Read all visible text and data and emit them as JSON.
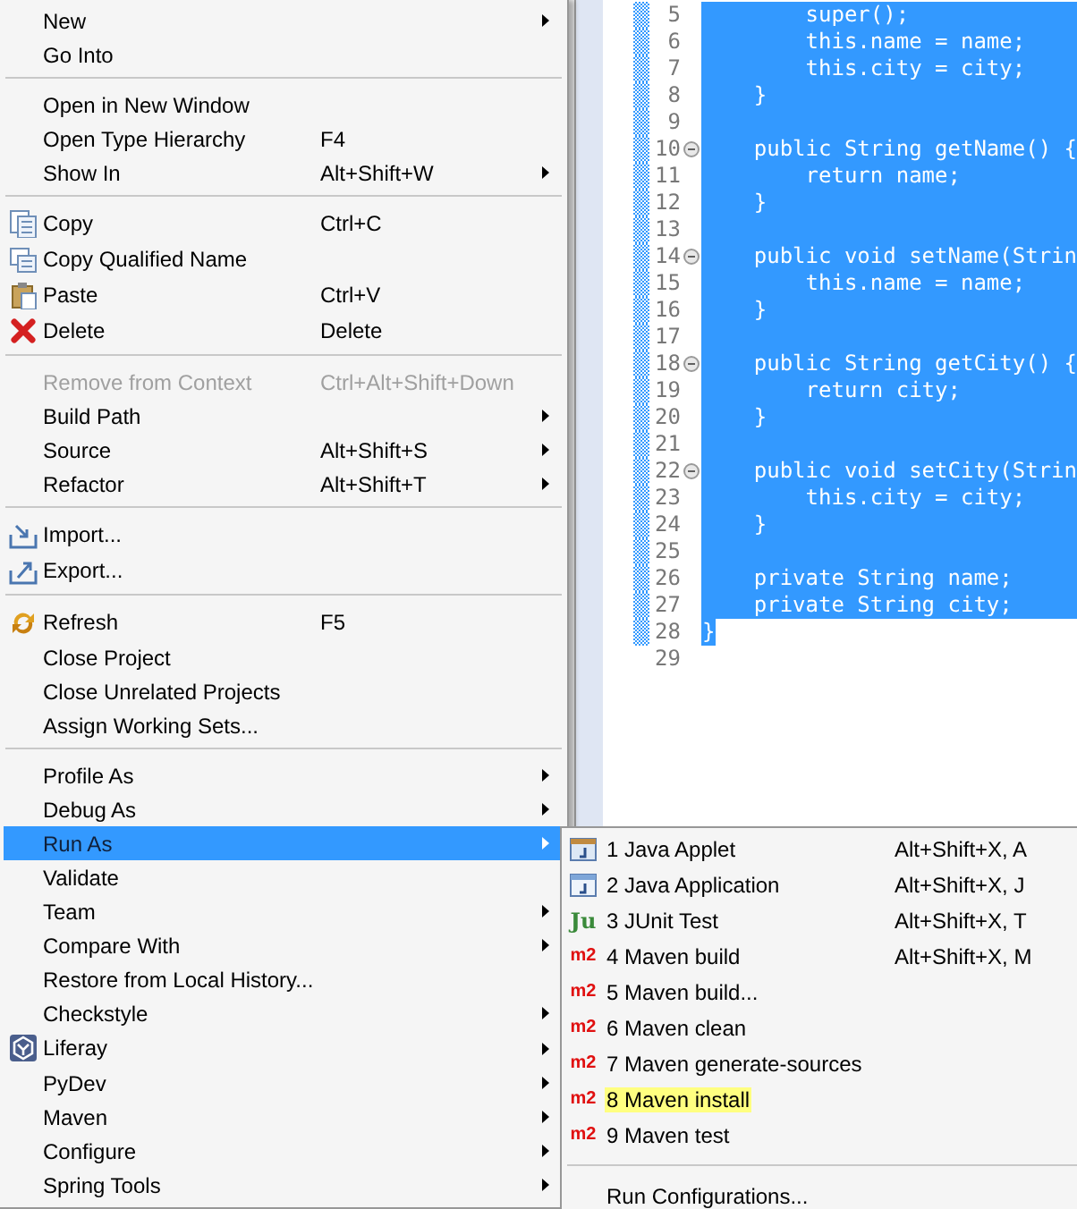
{
  "editor": {
    "lines": [
      {
        "number": "5",
        "code": "        super();",
        "selected": true,
        "folding": false
      },
      {
        "number": "6",
        "code": "        this.name = name;",
        "selected": true,
        "folding": false
      },
      {
        "number": "7",
        "code": "        this.city = city;",
        "selected": true,
        "folding": false
      },
      {
        "number": "8",
        "code": "    }",
        "selected": true,
        "folding": false
      },
      {
        "number": "9",
        "selected": true,
        "folding": false
      },
      {
        "number": "10",
        "code": "    public String getName() {",
        "selected": true,
        "folding": true
      },
      {
        "number": "11",
        "code": "        return name;",
        "selected": true,
        "folding": false
      },
      {
        "number": "12",
        "code": "    }",
        "selected": true,
        "folding": false
      },
      {
        "number": "13",
        "selected": true,
        "folding": false
      },
      {
        "number": "14",
        "code": "    public void setName(Strin",
        "selected": true,
        "folding": true
      },
      {
        "number": "15",
        "code": "        this.name = name;",
        "selected": true,
        "folding": false
      },
      {
        "number": "16",
        "code": "    }",
        "selected": true,
        "folding": false
      },
      {
        "number": "17",
        "selected": true,
        "folding": false
      },
      {
        "number": "18",
        "code": "    public String getCity() {",
        "selected": true,
        "folding": true
      },
      {
        "number": "19",
        "code": "        return city;",
        "selected": true,
        "folding": false
      },
      {
        "number": "20",
        "code": "    }",
        "selected": true,
        "folding": false
      },
      {
        "number": "21",
        "selected": true,
        "folding": false
      },
      {
        "number": "22",
        "code": "    public void setCity(Strin",
        "selected": true,
        "folding": true
      },
      {
        "number": "23",
        "code": "        this.city = city;",
        "selected": true,
        "folding": false
      },
      {
        "number": "24",
        "code": "    }",
        "selected": true,
        "folding": false
      },
      {
        "number": "25",
        "selected": true,
        "folding": false
      },
      {
        "number": "26",
        "code": "    private String name;",
        "selected": true,
        "folding": false
      },
      {
        "number": "27",
        "code": "    private String city;",
        "selected": true,
        "folding": false
      },
      {
        "number": "28",
        "code": "}",
        "selected": true,
        "folding": false
      },
      {
        "number": "29",
        "selected": false,
        "folding": false
      }
    ]
  },
  "context_menu": {
    "groups": [
      [
        {
          "label": "New",
          "submenu": true,
          "selected": false,
          "disabled": false
        },
        {
          "label": "Go Into",
          "submenu": false,
          "selected": false,
          "disabled": false
        }
      ],
      [
        {
          "label": "Open in New Window",
          "submenu": false,
          "selected": false,
          "disabled": false
        },
        {
          "label": "Open Type Hierarchy",
          "shortcut": "F4",
          "submenu": false,
          "selected": false,
          "disabled": false
        },
        {
          "label": "Show In",
          "shortcut": "Alt+Shift+W",
          "submenu": true,
          "selected": false,
          "disabled": false
        }
      ],
      [
        {
          "label": "Copy",
          "shortcut": "Ctrl+C",
          "kind": "copy",
          "submenu": false,
          "selected": false,
          "disabled": false
        },
        {
          "label": "Copy Qualified Name",
          "kind": "copy-qualified",
          "submenu": false,
          "selected": false,
          "disabled": false
        },
        {
          "label": "Paste",
          "shortcut": "Ctrl+V",
          "kind": "paste",
          "submenu": false,
          "selected": false,
          "disabled": false
        },
        {
          "label": "Delete",
          "shortcut": "Delete",
          "kind": "delete",
          "submenu": false,
          "selected": false,
          "disabled": false
        }
      ],
      [
        {
          "label": "Remove from Context",
          "shortcut": "Ctrl+Alt+Shift+Down",
          "submenu": false,
          "selected": false,
          "disabled": true
        },
        {
          "label": "Build Path",
          "submenu": true,
          "selected": false,
          "disabled": false
        },
        {
          "label": "Source",
          "shortcut": "Alt+Shift+S",
          "submenu": true,
          "selected": false,
          "disabled": false
        },
        {
          "label": "Refactor",
          "shortcut": "Alt+Shift+T",
          "submenu": true,
          "selected": false,
          "disabled": false
        }
      ],
      [
        {
          "label": "Import...",
          "kind": "import",
          "submenu": false,
          "selected": false,
          "disabled": false
        },
        {
          "label": "Export...",
          "kind": "export",
          "submenu": false,
          "selected": false,
          "disabled": false
        }
      ],
      [
        {
          "label": "Refresh",
          "shortcut": "F5",
          "kind": "refresh",
          "submenu": false,
          "selected": false,
          "disabled": false
        },
        {
          "label": "Close Project",
          "submenu": false,
          "selected": false,
          "disabled": false
        },
        {
          "label": "Close Unrelated Projects",
          "submenu": false,
          "selected": false,
          "disabled": false
        },
        {
          "label": "Assign Working Sets...",
          "submenu": false,
          "selected": false,
          "disabled": false
        }
      ],
      [
        {
          "label": "Profile As",
          "submenu": true,
          "selected": false,
          "disabled": false
        },
        {
          "label": "Debug As",
          "submenu": true,
          "selected": false,
          "disabled": false
        },
        {
          "label": "Run As",
          "submenu": true,
          "selected": true,
          "disabled": false
        },
        {
          "label": "Validate",
          "submenu": false,
          "selected": false,
          "disabled": false
        },
        {
          "label": "Team",
          "submenu": true,
          "selected": false,
          "disabled": false
        },
        {
          "label": "Compare With",
          "submenu": true,
          "selected": false,
          "disabled": false
        },
        {
          "label": "Restore from Local History...",
          "submenu": false,
          "selected": false,
          "disabled": false
        },
        {
          "label": "Checkstyle",
          "submenu": true,
          "selected": false,
          "disabled": false
        },
        {
          "label": "Liferay",
          "kind": "liferay",
          "submenu": true,
          "selected": false,
          "disabled": false
        },
        {
          "label": "PyDev",
          "submenu": true,
          "selected": false,
          "disabled": false
        },
        {
          "label": "Maven",
          "submenu": true,
          "selected": false,
          "disabled": false
        },
        {
          "label": "Configure",
          "submenu": true,
          "selected": false,
          "disabled": false
        },
        {
          "label": "Spring Tools",
          "submenu": true,
          "selected": false,
          "disabled": false
        }
      ]
    ]
  },
  "run_as_submenu": {
    "groups": [
      [
        {
          "kind": "applet",
          "label": "1 Java Applet",
          "shortcut": "Alt+Shift+X, A",
          "highlighted": false
        },
        {
          "kind": "application",
          "label": "2 Java Application",
          "shortcut": "Alt+Shift+X, J",
          "highlighted": false
        },
        {
          "kind": "junit",
          "badge": "Ju",
          "label": "3 JUnit Test",
          "shortcut": "Alt+Shift+X, T",
          "highlighted": false
        },
        {
          "kind": "maven",
          "badge": "m2",
          "label": "4 Maven build",
          "shortcut": "Alt+Shift+X, M",
          "highlighted": false
        },
        {
          "kind": "maven",
          "badge": "m2",
          "label": "5 Maven build...",
          "highlighted": false
        },
        {
          "kind": "maven",
          "badge": "m2",
          "label": "6 Maven clean",
          "highlighted": false
        },
        {
          "kind": "maven",
          "badge": "m2",
          "label": "7 Maven generate-sources",
          "highlighted": false
        },
        {
          "kind": "maven",
          "badge": "m2",
          "label": "8 Maven install",
          "highlighted": true
        },
        {
          "kind": "maven",
          "badge": "m2",
          "label": "9 Maven test",
          "highlighted": false
        }
      ],
      [
        {
          "kind": "plain",
          "label": "Run Configurations...",
          "highlighted": false
        }
      ]
    ]
  }
}
